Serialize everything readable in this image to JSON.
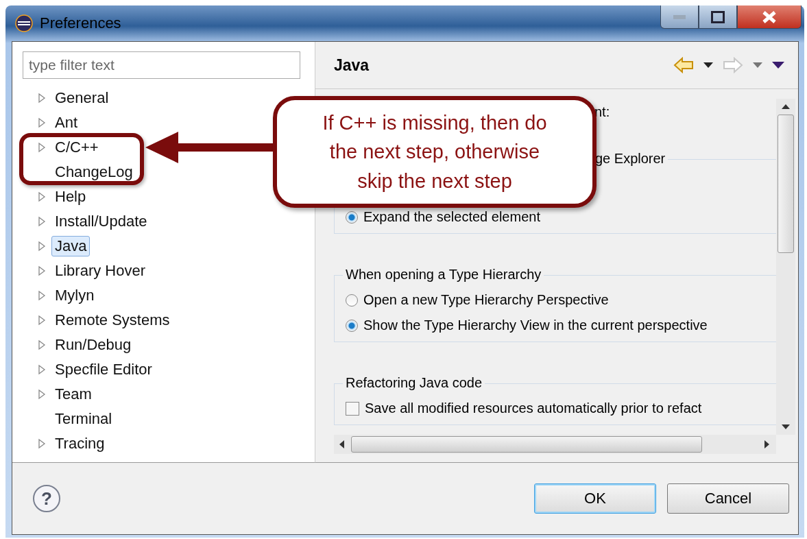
{
  "window": {
    "title": "Preferences"
  },
  "filter": {
    "placeholder": "type filter text"
  },
  "tree": [
    {
      "label": "General",
      "expandable": true,
      "selected": false
    },
    {
      "label": "Ant",
      "expandable": true,
      "selected": false
    },
    {
      "label": "C/C++",
      "expandable": true,
      "selected": false
    },
    {
      "label": "ChangeLog",
      "expandable": false,
      "selected": false
    },
    {
      "label": "Help",
      "expandable": true,
      "selected": false
    },
    {
      "label": "Install/Update",
      "expandable": true,
      "selected": false
    },
    {
      "label": "Java",
      "expandable": true,
      "selected": true
    },
    {
      "label": "Library Hover",
      "expandable": true,
      "selected": false
    },
    {
      "label": "Mylyn",
      "expandable": true,
      "selected": false
    },
    {
      "label": "Remote Systems",
      "expandable": true,
      "selected": false
    },
    {
      "label": "Run/Debug",
      "expandable": true,
      "selected": false
    },
    {
      "label": "Specfile Editor",
      "expandable": true,
      "selected": false
    },
    {
      "label": "Team",
      "expandable": true,
      "selected": false
    },
    {
      "label": "Terminal",
      "expandable": false,
      "selected": false
    },
    {
      "label": "Tracing",
      "expandable": true,
      "selected": false
    }
  ],
  "page": {
    "title": "Java",
    "nav": {
      "back_enabled": true,
      "forward_enabled": false
    }
  },
  "content": {
    "label_fragment": "nt:",
    "groups": [
      {
        "legend": "ge Explorer",
        "partial": true,
        "items": [
          {
            "kind": "radio",
            "label": "Expand the selected element",
            "selected": true
          }
        ]
      },
      {
        "legend": "When opening a Type Hierarchy",
        "items": [
          {
            "kind": "radio",
            "label": "Open a new Type Hierarchy Perspective",
            "selected": false
          },
          {
            "kind": "radio",
            "label": "Show the Type Hierarchy View in the current perspective",
            "selected": true
          }
        ]
      },
      {
        "legend": "Refactoring Java code",
        "items": [
          {
            "kind": "checkbox",
            "label": "Save all modified resources automatically prior to refact",
            "checked": false
          }
        ]
      }
    ]
  },
  "help_button": "?",
  "buttons": [
    "OK",
    "Cancel"
  ],
  "callout": {
    "text": "If C++ is missing, then do the next step, otherwise skip the next step"
  }
}
